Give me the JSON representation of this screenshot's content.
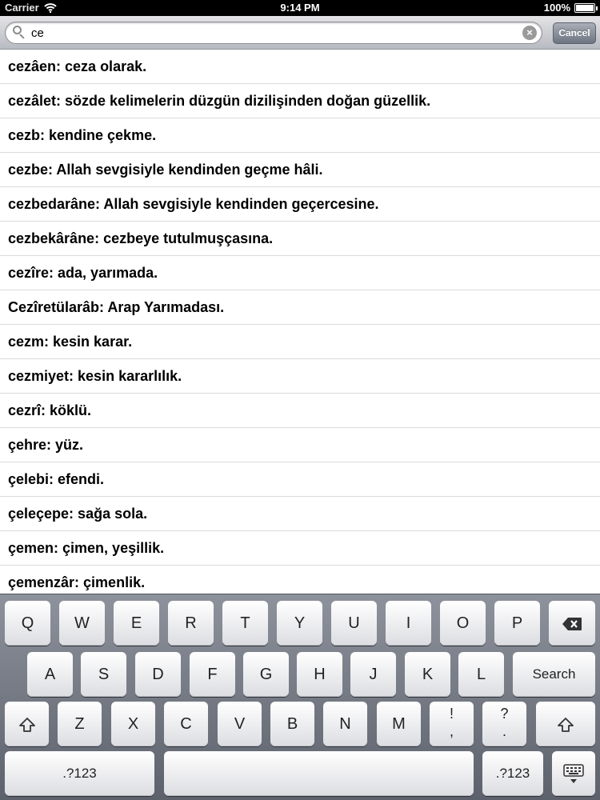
{
  "status_bar": {
    "carrier": "Carrier",
    "time": "9:14 PM",
    "battery": "100%"
  },
  "search": {
    "value": "ce",
    "cancel_label": "Cancel"
  },
  "results": [
    "cezâen: ceza olarak.",
    "cezâlet: sözde kelimelerin düzgün dizilişinden doğan güzellik.",
    "cezb: kendine çekme.",
    "cezbe: Allah sevgisiyle kendinden geçme hâli.",
    "cezbedarâne: Allah sevgisiyle kendinden geçercesine.",
    "cezbekârâne: cezbeye tutulmuşçasına.",
    "cezîre: ada, yarımada.",
    "Cezîretülarâb: Arap Yarımadası.",
    "cezm: kesin karar.",
    "cezmiyet: kesin kararlılık.",
    "cezrî: köklü.",
    "çehre: yüz.",
    "çelebi: efendi.",
    "çeleçepe: sağa sola.",
    "çemen: çimen, yeşillik.",
    "çemenzâr: çimenlik."
  ],
  "keyboard": {
    "row1": [
      "Q",
      "W",
      "E",
      "R",
      "T",
      "Y",
      "U",
      "I",
      "O",
      "P"
    ],
    "row2": [
      "A",
      "S",
      "D",
      "F",
      "G",
      "H",
      "J",
      "K",
      "L"
    ],
    "row3": [
      "Z",
      "X",
      "C",
      "V",
      "B",
      "N",
      "M"
    ],
    "exclaim_top": "!",
    "exclaim_bottom": ",",
    "question_top": "?",
    "question_bottom": ".",
    "search_label": "Search",
    "numbers_label": ".?123",
    "backspace_icon": "backspace-icon",
    "shift_icon": "shift-icon",
    "hide_keyboard_icon": "keyboard-hide-icon"
  }
}
